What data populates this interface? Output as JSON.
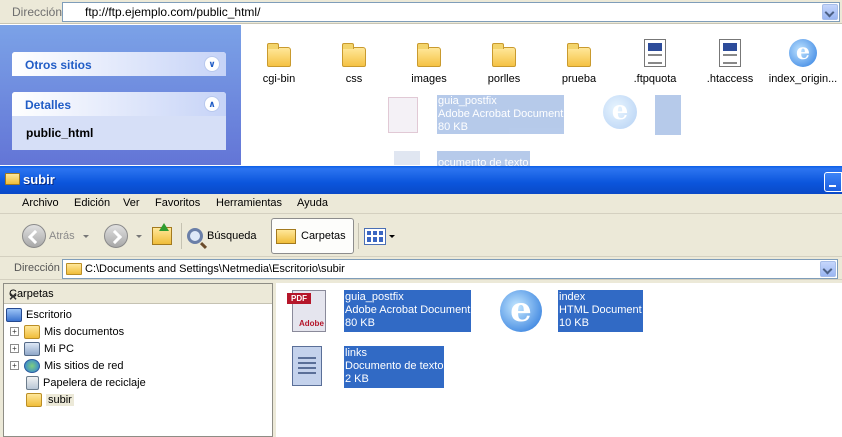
{
  "ftp_window": {
    "address_label": "Dirección",
    "address_value": "ftp://ftp.ejemplo.com/public_html/",
    "task_pane": {
      "other_places_title": "Otros sitios",
      "details_title": "Detalles",
      "details_value": "public_html"
    },
    "files": [
      {
        "name": "cgi-bin",
        "icon": "folder-icon"
      },
      {
        "name": "css",
        "icon": "folder-icon"
      },
      {
        "name": "images",
        "icon": "folder-icon"
      },
      {
        "name": "porlles",
        "icon": "folder-icon"
      },
      {
        "name": "prueba",
        "icon": "folder-icon"
      },
      {
        "name": ".ftpquota",
        "icon": "file-icon"
      },
      {
        "name": ".htaccess",
        "icon": "file-icon"
      },
      {
        "name": "index_origin...",
        "icon": "ie-document-icon"
      }
    ],
    "drag_ghost": {
      "pdf_name": "guia_postfix",
      "pdf_type": "Adobe Acrobat Document",
      "pdf_size": "80 KB",
      "txt_type": "Documento de texto",
      "txt_partial": "ocumento de texto"
    }
  },
  "explorer_window": {
    "title": "subir",
    "menu": [
      "Archivo",
      "Edición",
      "Ver",
      "Favoritos",
      "Herramientas",
      "Ayuda"
    ],
    "toolbar": {
      "back_label": "Atrás",
      "search_label": "Búsqueda",
      "folders_label": "Carpetas"
    },
    "address_label": "Dirección",
    "address_value": "C:\\Documents and Settings\\Netmedia\\Escritorio\\subir",
    "folders_pane": {
      "title": "Carpetas",
      "close": "×",
      "tree": [
        {
          "label": "Escritorio",
          "icon": "desktop-icon"
        },
        {
          "label": "Mis documentos",
          "icon": "my-documents-icon",
          "expander": "+"
        },
        {
          "label": "Mi PC",
          "icon": "my-computer-icon",
          "expander": "+"
        },
        {
          "label": "Mis sitios de red",
          "icon": "network-places-icon",
          "expander": "+"
        },
        {
          "label": "Papelera de reciclaje",
          "icon": "recycle-bin-icon"
        },
        {
          "label": "subir",
          "icon": "folder-icon"
        }
      ]
    },
    "files": [
      {
        "name": "guia_postfix",
        "type": "Adobe Acrobat Document",
        "size": "80 KB",
        "icon": "pdf-icon"
      },
      {
        "name": "index",
        "type": "HTML Document",
        "size": "10 KB",
        "icon": "ie-document-icon"
      },
      {
        "name": "links",
        "type": "Documento de texto",
        "size": "2 KB",
        "icon": "text-document-icon"
      }
    ]
  },
  "colors": {
    "title_bar": "#0a55dc",
    "selection": "#316ac5",
    "task_pane": "#6f8fe0",
    "chrome": "#ece9d8"
  }
}
